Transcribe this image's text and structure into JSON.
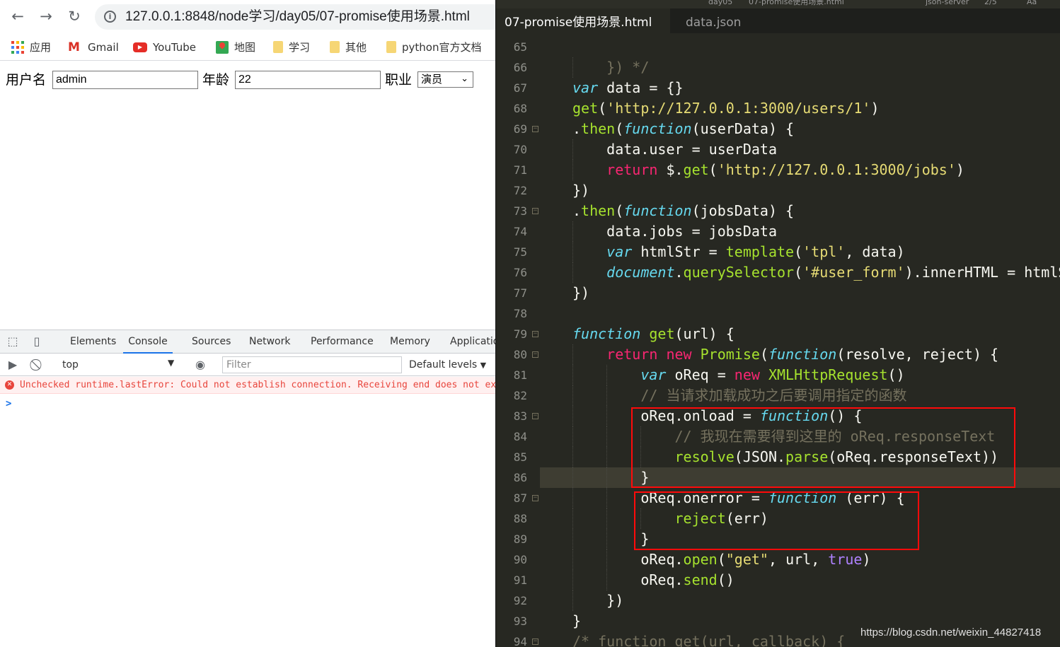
{
  "browser": {
    "url": "127.0.0.1:8848/node学习/day05/07-promise使用场景.html",
    "bookmarks": [
      "应用",
      "Gmail",
      "YouTube",
      "地图",
      "学习",
      "其他",
      "python官方文档"
    ],
    "form": {
      "username_label": "用户名",
      "username_value": "admin",
      "age_label": "年龄",
      "age_value": "22",
      "job_label": "职业",
      "job_selected": "演员"
    }
  },
  "devtools": {
    "tabs": [
      "Elements",
      "Console",
      "Sources",
      "Network",
      "Performance",
      "Memory",
      "Applicatio"
    ],
    "active_tab": "Console",
    "context": "top",
    "filter_placeholder": "Filter",
    "levels": "Default levels",
    "error_message": "Unchecked runtime.lastError: Could not establish connection. Receiving end does not exist.",
    "prompt": ">"
  },
  "editor": {
    "top_strip": [
      "day05",
      "07-promise使用场景.html",
      "json-server",
      "2/5",
      "Aa"
    ],
    "tabs": [
      "07-promise使用场景.html",
      "data.json"
    ],
    "active_tab": "07-promise使用场景.html",
    "lines": [
      {
        "n": "65",
        "fold": false,
        "tokens": []
      },
      {
        "n": "66",
        "fold": false,
        "tokens": [
          [
            "c",
            "    }) */"
          ]
        ]
      },
      {
        "n": "67",
        "fold": false,
        "tokens": [
          [
            "i",
            "var"
          ],
          [
            "",
            " data = {}"
          ]
        ]
      },
      {
        "n": "68",
        "fold": false,
        "tokens": [
          [
            "f",
            "get"
          ],
          [
            "",
            "("
          ],
          [
            "s",
            "'http://127.0.0.1:3000/users/1'"
          ],
          [
            "",
            ")"
          ]
        ]
      },
      {
        "n": "69",
        "fold": true,
        "tokens": [
          [
            "",
            "."
          ],
          [
            "f",
            "then"
          ],
          [
            "",
            "("
          ],
          [
            "i",
            "function"
          ],
          [
            "",
            "(userData) {"
          ]
        ]
      },
      {
        "n": "70",
        "fold": false,
        "tokens": [
          [
            "",
            "    data.user = userData"
          ]
        ]
      },
      {
        "n": "71",
        "fold": false,
        "tokens": [
          [
            "k",
            "    return"
          ],
          [
            "",
            " $."
          ],
          [
            "f",
            "get"
          ],
          [
            "",
            "("
          ],
          [
            "s",
            "'http://127.0.0.1:3000/jobs'"
          ],
          [
            "",
            ")"
          ]
        ]
      },
      {
        "n": "72",
        "fold": false,
        "tokens": [
          [
            "",
            "})"
          ]
        ]
      },
      {
        "n": "73",
        "fold": true,
        "tokens": [
          [
            "",
            "."
          ],
          [
            "f",
            "then"
          ],
          [
            "",
            "("
          ],
          [
            "i",
            "function"
          ],
          [
            "",
            "(jobsData) {"
          ]
        ]
      },
      {
        "n": "74",
        "fold": false,
        "tokens": [
          [
            "",
            "    data.jobs = jobsData"
          ]
        ]
      },
      {
        "n": "75",
        "fold": false,
        "tokens": [
          [
            "i",
            "    var"
          ],
          [
            "",
            " htmlStr = "
          ],
          [
            "f",
            "template"
          ],
          [
            "",
            "("
          ],
          [
            "s",
            "'tpl'"
          ],
          [
            "",
            ", data)"
          ]
        ]
      },
      {
        "n": "76",
        "fold": false,
        "tokens": [
          [
            "i",
            "    document"
          ],
          [
            "",
            "."
          ],
          [
            "f",
            "querySelector"
          ],
          [
            "",
            "("
          ],
          [
            "s",
            "'#user_form'"
          ],
          [
            "",
            ").innerHTML = htmlStr"
          ]
        ]
      },
      {
        "n": "77",
        "fold": false,
        "tokens": [
          [
            "",
            "})"
          ]
        ]
      },
      {
        "n": "78",
        "fold": false,
        "tokens": []
      },
      {
        "n": "79",
        "fold": true,
        "tokens": [
          [
            "i",
            "function"
          ],
          [
            "",
            " "
          ],
          [
            "f",
            "get"
          ],
          [
            "",
            "(url) {"
          ]
        ]
      },
      {
        "n": "80",
        "fold": true,
        "tokens": [
          [
            "k",
            "    return"
          ],
          [
            "",
            " "
          ],
          [
            "k",
            "new"
          ],
          [
            "",
            " "
          ],
          [
            "f",
            "Promise"
          ],
          [
            "",
            "("
          ],
          [
            "i",
            "function"
          ],
          [
            "",
            "(resolve, reject) {"
          ]
        ]
      },
      {
        "n": "81",
        "fold": false,
        "tokens": [
          [
            "i",
            "        var"
          ],
          [
            "",
            " oReq = "
          ],
          [
            "k",
            "new"
          ],
          [
            "",
            " "
          ],
          [
            "f",
            "XMLHttpRequest"
          ],
          [
            "",
            "()"
          ]
        ]
      },
      {
        "n": "82",
        "fold": false,
        "tokens": [
          [
            "c",
            "        // 当请求加载成功之后要调用指定的函数"
          ]
        ]
      },
      {
        "n": "83",
        "fold": true,
        "tokens": [
          [
            "",
            "        oReq.onload = "
          ],
          [
            "i",
            "function"
          ],
          [
            "",
            "() {"
          ]
        ]
      },
      {
        "n": "84",
        "fold": false,
        "tokens": [
          [
            "c",
            "            // 我现在需要得到这里的 oReq.responseText"
          ]
        ]
      },
      {
        "n": "85",
        "fold": false,
        "tokens": [
          [
            "f",
            "            resolve"
          ],
          [
            "",
            "(JSON."
          ],
          [
            "f",
            "parse"
          ],
          [
            "",
            "(oReq.responseText))"
          ]
        ]
      },
      {
        "n": "86",
        "fold": false,
        "tokens": [
          [
            "",
            "        }"
          ]
        ]
      },
      {
        "n": "87",
        "fold": true,
        "tokens": [
          [
            "",
            "        oReq.onerror = "
          ],
          [
            "i",
            "function"
          ],
          [
            "",
            " (err) {"
          ]
        ]
      },
      {
        "n": "88",
        "fold": false,
        "tokens": [
          [
            "f",
            "            reject"
          ],
          [
            "",
            "(err)"
          ]
        ]
      },
      {
        "n": "89",
        "fold": false,
        "tokens": [
          [
            "",
            "        }"
          ]
        ]
      },
      {
        "n": "90",
        "fold": false,
        "tokens": [
          [
            "",
            "        oReq."
          ],
          [
            "f",
            "open"
          ],
          [
            "",
            "("
          ],
          [
            "s",
            "\"get\""
          ],
          [
            "",
            ", url, "
          ],
          [
            "n",
            "true"
          ],
          [
            "",
            ")"
          ]
        ]
      },
      {
        "n": "91",
        "fold": false,
        "tokens": [
          [
            "",
            "        oReq."
          ],
          [
            "f",
            "send"
          ],
          [
            "",
            "()"
          ]
        ]
      },
      {
        "n": "92",
        "fold": false,
        "tokens": [
          [
            "",
            "    })"
          ]
        ]
      },
      {
        "n": "93",
        "fold": false,
        "tokens": [
          [
            "",
            "}"
          ]
        ]
      },
      {
        "n": "94",
        "fold": true,
        "tokens": [
          [
            "c",
            "/* function get(url, callback) {"
          ]
        ]
      }
    ]
  },
  "watermark": "https://blog.csdn.net/weixin_44827418",
  "colors": {
    "editor_bg": "#272822",
    "highlight_box": "#ff0a0a",
    "devtools_accent": "#1a73e8",
    "error": "#e8453c"
  }
}
